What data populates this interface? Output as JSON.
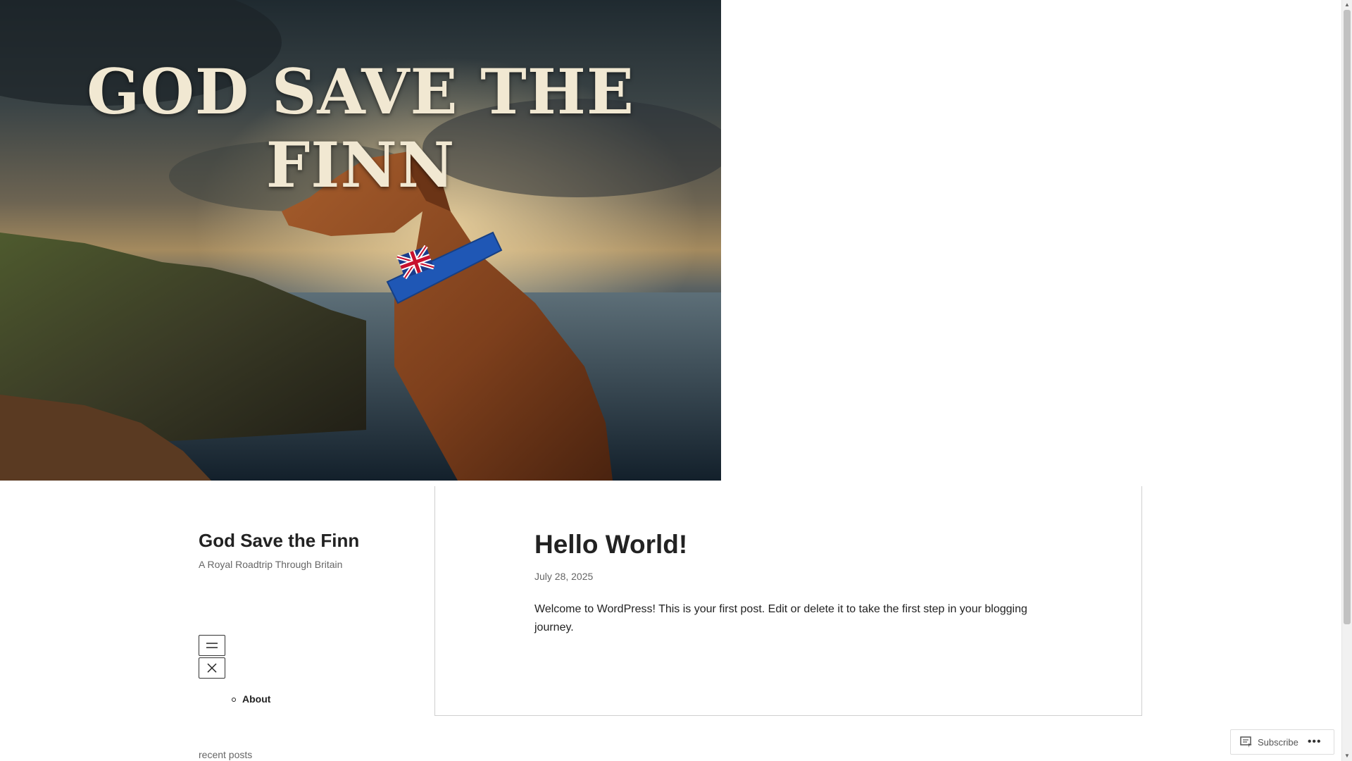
{
  "header": {
    "image_title": "GOD SAVE THE FINN"
  },
  "site": {
    "title": "God Save the Finn",
    "tagline": "A Royal Roadtrip Through Britain"
  },
  "nav": {
    "open_icon": "hamburger-icon",
    "close_icon": "close-icon",
    "items": [
      {
        "label": "About"
      }
    ]
  },
  "sidebar": {
    "recent_posts_heading": "recent posts"
  },
  "post": {
    "title": "Hello World!",
    "date": "July 28, 2025",
    "body": "Welcome to WordPress! This is your first post. Edit or delete it to take the first step in your blogging journey."
  },
  "subscribe": {
    "label": "Subscribe",
    "icon": "reader-icon",
    "more_icon": "ellipsis-icon"
  },
  "colors": {
    "text": "#222222",
    "muted": "#666666",
    "border": "#cfcfcf",
    "collar": "#1f57b5",
    "dog": "#8a4a22"
  }
}
